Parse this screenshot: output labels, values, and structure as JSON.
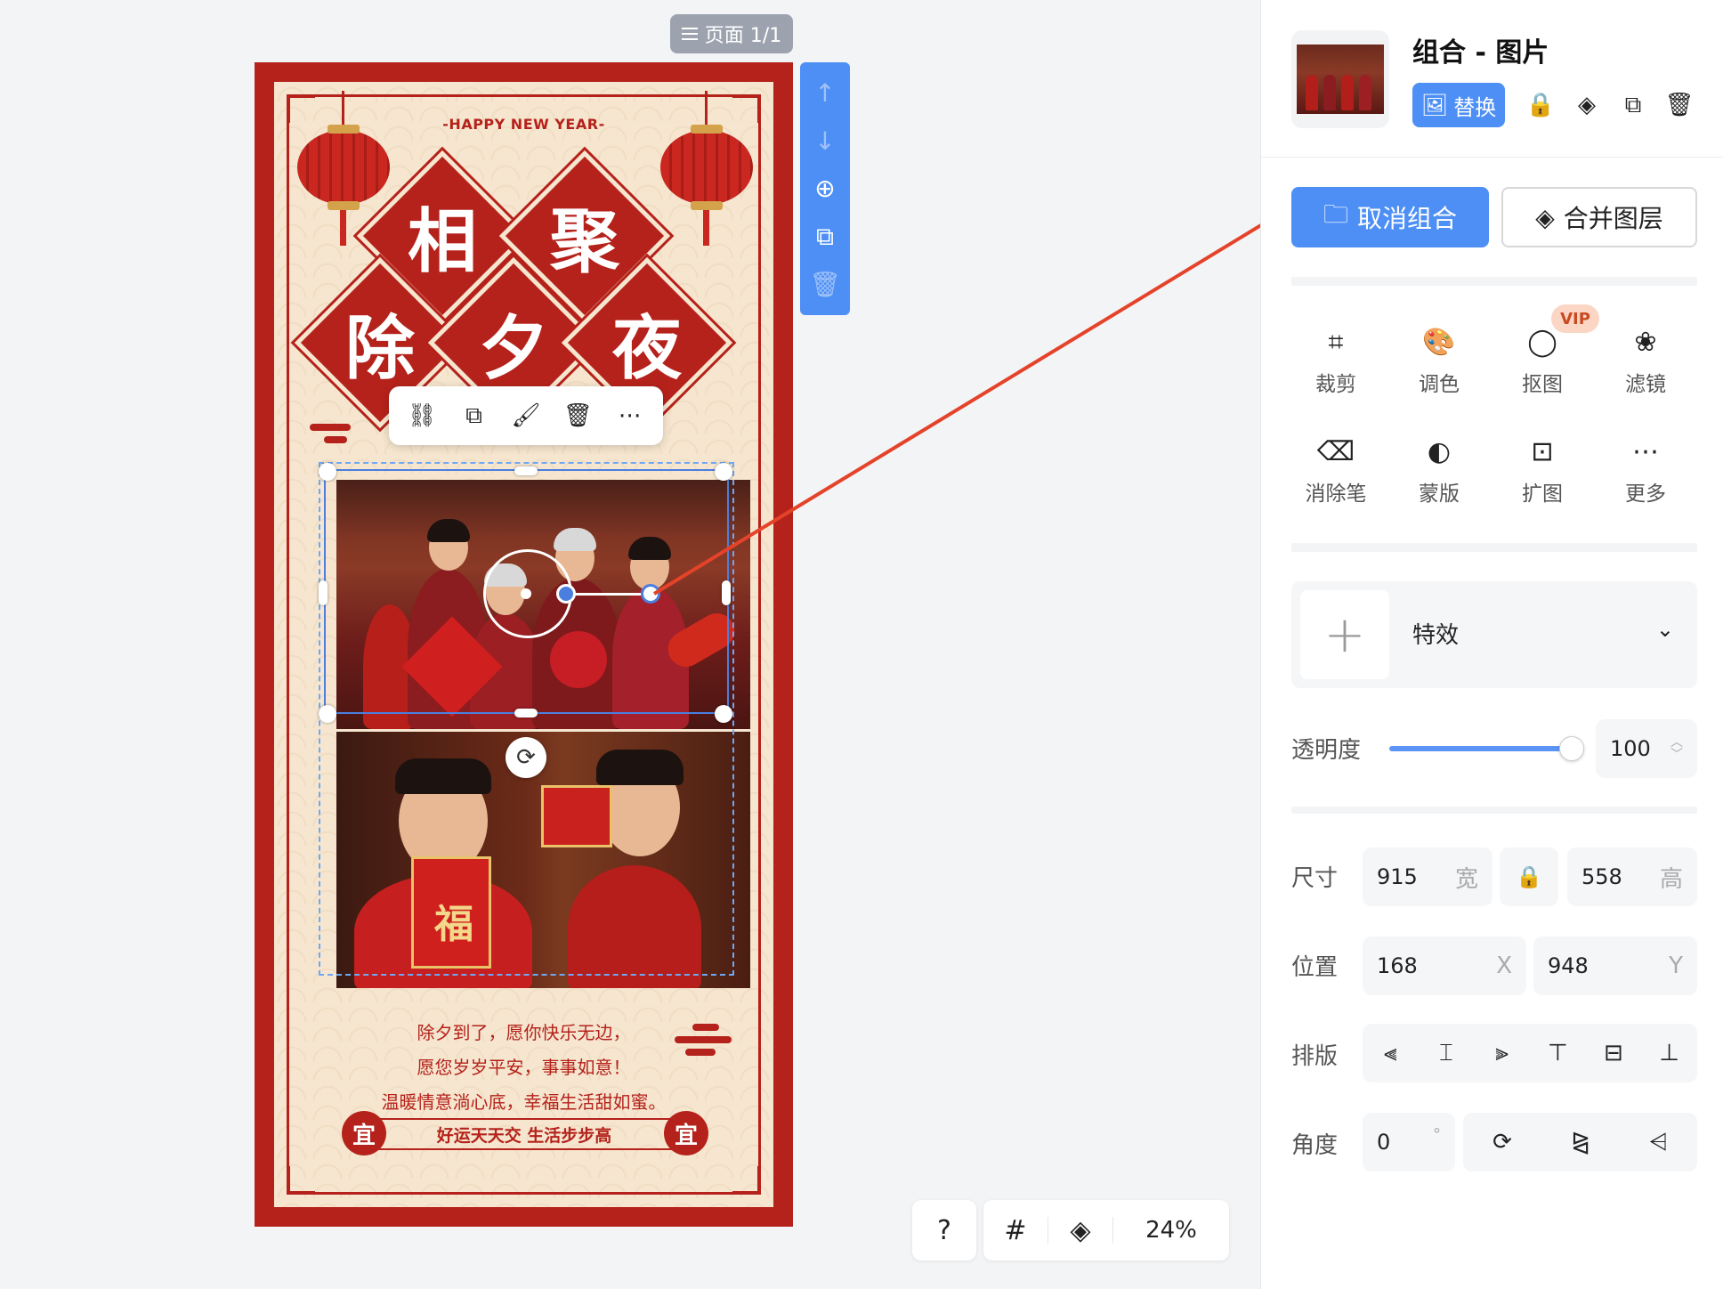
{
  "canvas": {
    "page_indicator": "页面 1/1",
    "zoom": "24%"
  },
  "poster": {
    "happy_new_year": "-HAPPY NEW YEAR-",
    "title_chars": [
      "相",
      "聚",
      "除",
      "夕",
      "夜"
    ],
    "greeting_lines": [
      "除夕到了，愿你快乐无边，",
      "愿您岁岁平安，事事如意！",
      "温暖情意淌心底，幸福生活甜如蜜。"
    ],
    "slogan": "好运天天交  生活步步高",
    "badge_char": "宜",
    "poster_color": "#b5221b",
    "background_color": "#f6e6cf"
  },
  "panel": {
    "title": "组合 - 图片",
    "replace_label": "替换",
    "ungroup_label": "取消组合",
    "merge_label": "合并图层",
    "vip_badge": "VIP",
    "tools": [
      {
        "label": "裁剪",
        "icon": "crop-icon"
      },
      {
        "label": "调色",
        "icon": "palette-icon"
      },
      {
        "label": "抠图",
        "icon": "cutout-icon"
      },
      {
        "label": "滤镜",
        "icon": "filter-icon"
      },
      {
        "label": "消除笔",
        "icon": "eraser-icon"
      },
      {
        "label": "蒙版",
        "icon": "mask-icon"
      },
      {
        "label": "扩图",
        "icon": "ai-expand-icon"
      },
      {
        "label": "更多",
        "icon": "more-icon"
      }
    ],
    "effect_label": "特效",
    "opacity": {
      "label": "透明度",
      "value": "100",
      "percent": 100
    },
    "size": {
      "label": "尺寸",
      "width": "915",
      "width_suffix": "宽",
      "height": "558",
      "height_suffix": "高"
    },
    "position": {
      "label": "位置",
      "x": "168",
      "x_suffix": "X",
      "y": "948",
      "y_suffix": "Y"
    },
    "layout_label": "排版",
    "angle": {
      "label": "角度",
      "value": "0",
      "unit": "°"
    },
    "accent_color": "#4d8ff5"
  }
}
